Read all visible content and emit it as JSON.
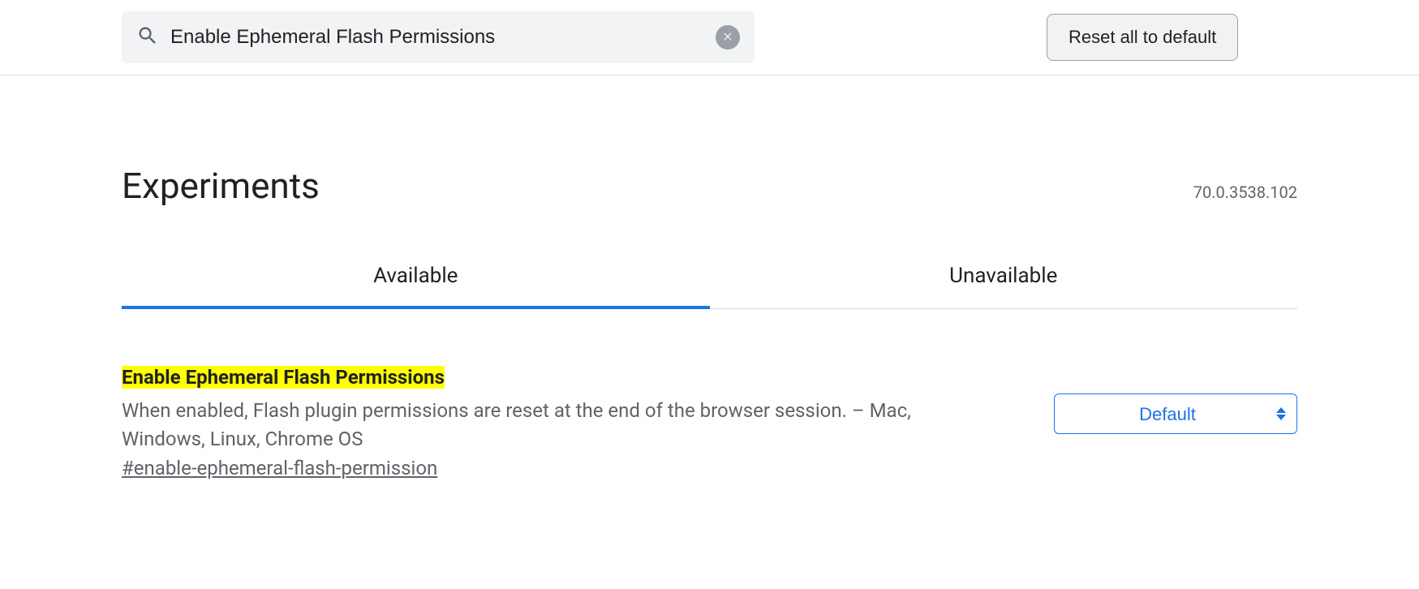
{
  "header": {
    "search_value": "Enable Ephemeral Flash Permissions",
    "reset_label": "Reset all to default"
  },
  "page": {
    "title": "Experiments",
    "version": "70.0.3538.102"
  },
  "tabs": {
    "available": "Available",
    "unavailable": "Unavailable"
  },
  "flag": {
    "title": "Enable Ephemeral Flash Permissions",
    "description": "When enabled, Flash plugin permissions are reset at the end of the browser session. – Mac, Windows, Linux, Chrome OS",
    "hash": "#enable-ephemeral-flash-permission",
    "select_value": "Default"
  }
}
